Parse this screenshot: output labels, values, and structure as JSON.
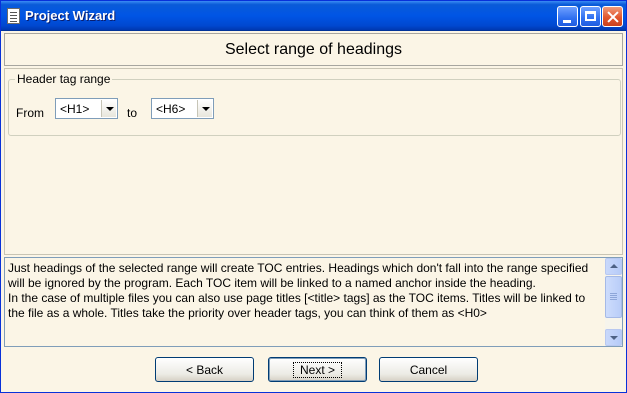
{
  "window": {
    "title": "Project Wizard",
    "controls": [
      "minimize",
      "maximize",
      "close"
    ]
  },
  "header": {
    "title": "Select range of headings"
  },
  "range_group": {
    "legend": "Header tag range",
    "from_label": "From",
    "to_label": "to",
    "from_value": "<H1>",
    "to_value": "<H6>"
  },
  "description": {
    "paragraph1": "Just headings of the selected range will create TOC entries. Headings which don't fall into the range specified will be ignored by the program. Each TOC item will be linked to a named anchor inside the heading.",
    "paragraph2": "In the case of multiple files you can also use page titles [<title> tags] as the TOC items. Titles will be linked to the file as a whole. Titles take the priority over header tags, you can think of them as <H0>"
  },
  "buttons": {
    "back": "< Back",
    "next": "Next >",
    "cancel": "Cancel"
  }
}
